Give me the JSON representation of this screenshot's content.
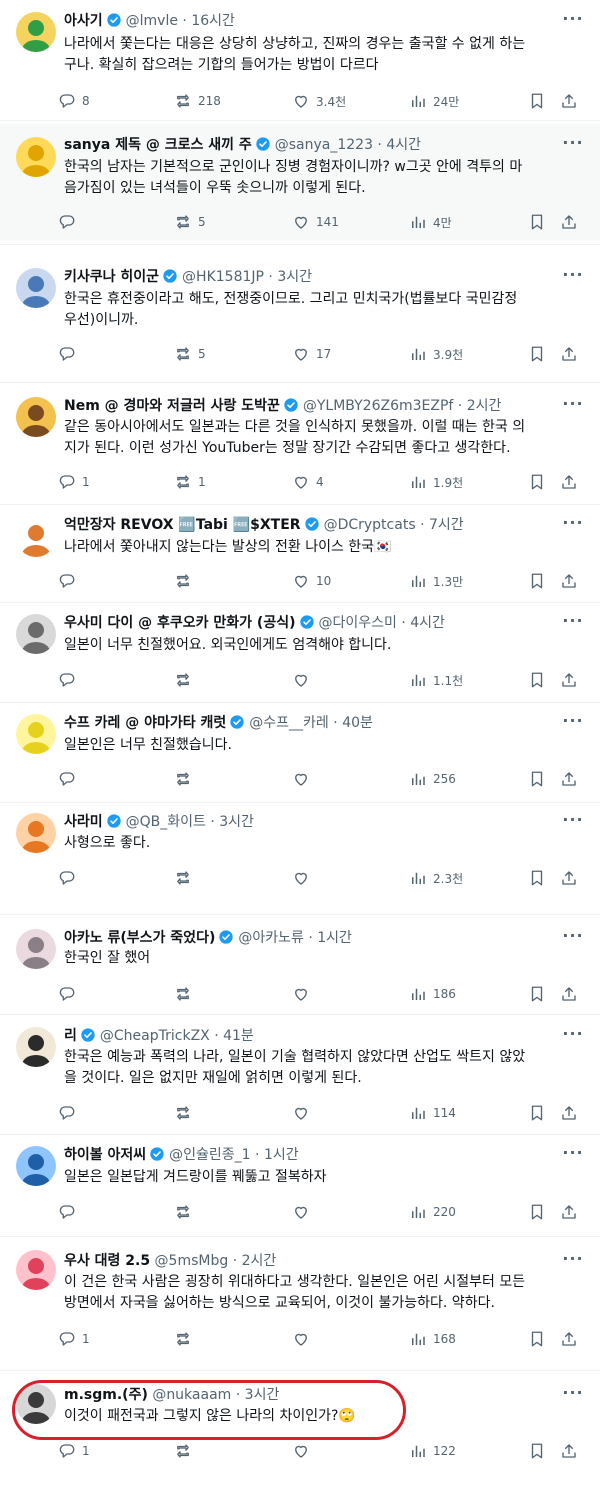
{
  "colors": {
    "verified": "#1d9bf0",
    "icon": "#536471",
    "highlight": "#d8202c"
  },
  "icons": {
    "reply": "reply-icon",
    "retweet": "retweet-icon",
    "like": "like-icon",
    "views": "views-icon",
    "bookmark": "bookmark-icon",
    "share": "share-icon",
    "verified": "verified-badge-icon",
    "more": "more-icon"
  },
  "tweets": [
    {
      "name": "아사기",
      "verified": true,
      "handle": "@lmvle",
      "time": "16시간",
      "lines": [
        "나라에서 쫓는다는 대응은 상당히 상냥하고, 진짜의 경우는 출국할 수 없게 하는",
        "구나. 확실히 잡으려는 기합의 들어가는 방법이 다르다"
      ],
      "replies": "8",
      "retweets": "218",
      "likes": "3.4천",
      "views": "24만"
    },
    {
      "name": "sanya 제독 @ 크로스 새끼 주",
      "verified": true,
      "handle": "@sanya_1223",
      "time": "4시간",
      "lines": [
        "한국의 남자는 기본적으로 군인이나 징병 경험자이니까? w그곳 안에 격투의 마",
        "음가짐이 있는 녀석들이 우뚝 솟으니까 이렇게 된다."
      ],
      "replies": "",
      "retweets": "5",
      "likes": "141",
      "views": "4만"
    },
    {
      "name": "키사쿠나 히이군",
      "verified": true,
      "handle": "@HK1581JP",
      "time": "3시간",
      "lines": [
        "한국은 휴전중이라고 해도, 전쟁중이므로. 그리고 민치국가(법률보다 국민감정",
        "우선)이니까."
      ],
      "replies": "",
      "retweets": "5",
      "likes": "17",
      "views": "3.9천"
    },
    {
      "name": "Nem @ 경마와 저글러 사랑 도박꾼",
      "verified": true,
      "handle": "@YLMBY26Z6m3EZPf",
      "time": "2시간",
      "lines": [
        "같은 동아시아에서도 일본과는 다른 것을 인식하지 못했을까. 이럴 때는 한국 의",
        "지가 된다. 이런 성가신 YouTuber는 정말 장기간 수감되면 좋다고 생각한다."
      ],
      "replies": "1",
      "retweets": "1",
      "likes": "4",
      "views": "1.9천"
    },
    {
      "name": "억만장자 REVOX 🆓Tabi 🆓$XTER",
      "verified": true,
      "handle": "@DCryptcats",
      "time": "7시간",
      "lines": [
        "나라에서 쫓아내지 않는다는 발상의 전환 나이스 한국🇰🇷"
      ],
      "replies": "",
      "retweets": "",
      "likes": "10",
      "views": "1.3만"
    },
    {
      "name": "우사미 다이 @ 후쿠오카 만화가 (공식)",
      "verified": true,
      "handle": "@다이우스미",
      "time": "4시간",
      "lines": [
        "일본이 너무 친절했어요. 외국인에게도 엄격해야 합니다."
      ],
      "replies": "",
      "retweets": "",
      "likes": "",
      "views": "1.1천"
    },
    {
      "name": "수프 카레 @ 야마가타 캐럿",
      "verified": true,
      "handle": "@수프__카레",
      "time": "40분",
      "lines": [
        "일본인은 너무 친절했습니다."
      ],
      "replies": "",
      "retweets": "",
      "likes": "",
      "views": "256"
    },
    {
      "name": "사라미",
      "verified": true,
      "handle": "@QB_화이트",
      "time": "3시간",
      "lines": [
        "사형으로 좋다."
      ],
      "replies": "",
      "retweets": "",
      "likes": "",
      "views": "2.3천"
    },
    {
      "name": "아카노 류(부스가 죽었다)",
      "verified": true,
      "handle": "@아카노류",
      "time": "1시간",
      "lines": [
        "한국인 잘 했어"
      ],
      "replies": "",
      "retweets": "",
      "likes": "",
      "views": "186"
    },
    {
      "name": "리",
      "verified": true,
      "handle": "@CheapTrickZX",
      "time": "41분",
      "lines": [
        "한국은 예능과 폭력의 나라, 일본이 기술 협력하지 않았다면 산업도 싹트지 않았",
        "을 것이다. 일은 없지만 재일에 얽히면 이렇게 된다."
      ],
      "replies": "",
      "retweets": "",
      "likes": "",
      "views": "114"
    },
    {
      "name": "하이볼 아저씨",
      "verified": true,
      "handle": "@인슐린종_1",
      "time": "1시간",
      "lines": [
        "일본은 일본답게 겨드랑이를 꿰뚫고 절복하자"
      ],
      "replies": "",
      "retweets": "",
      "likes": "",
      "views": "220"
    },
    {
      "name": "우사 대령 2.5",
      "verified": false,
      "handle": "@5msMbg",
      "time": "2시간",
      "lines": [
        "이 건은 한국 사람은 굉장히 위대하다고 생각한다. 일본인은 어린 시절부터 모든",
        "방면에서 자국을 싫어하는 방식으로 교육되어, 이것이 불가능하다. 약하다."
      ],
      "replies": "1",
      "retweets": "",
      "likes": "",
      "views": "168"
    },
    {
      "name": "m.sgm.(주)",
      "verified": false,
      "handle": "@nukaaam",
      "time": "3시간",
      "lines": [
        "이것이 패전국과 그렇지 않은 나라의 차이인가?🙄"
      ],
      "replies": "1",
      "retweets": "",
      "likes": "",
      "views": "122"
    }
  ]
}
